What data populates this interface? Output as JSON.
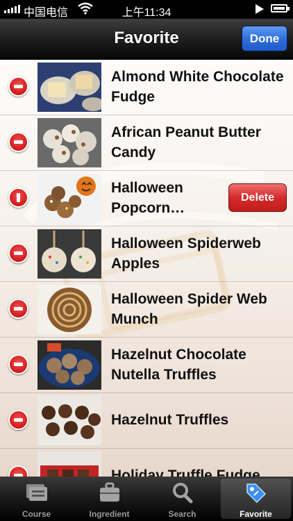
{
  "status_bar": {
    "carrier": "中国电信",
    "time": "上午11:34"
  },
  "nav": {
    "title": "Favorite",
    "done_label": "Done"
  },
  "list": {
    "items": [
      {
        "title": "Almond White Chocolate Fudge",
        "control": "remove"
      },
      {
        "title": "African Peanut Butter Candy",
        "control": "remove"
      },
      {
        "title": "Halloween Popcorn…",
        "control": "confirm",
        "delete_label": "Delete"
      },
      {
        "title": "Halloween Spiderweb Apples",
        "control": "remove"
      },
      {
        "title": "Halloween Spider Web Munch",
        "control": "remove"
      },
      {
        "title": "Hazelnut Chocolate Nutella Truffles",
        "control": "remove"
      },
      {
        "title": "Hazelnut Truffles",
        "control": "remove"
      },
      {
        "title": "Holiday Truffle Fudge",
        "control": "remove"
      }
    ],
    "watermark_icon": "recipes-logo-watermark"
  },
  "tab_bar": {
    "tabs": [
      {
        "label": "Course",
        "icon": "course-icon"
      },
      {
        "label": "Ingredient",
        "icon": "briefcase-icon"
      },
      {
        "label": "Search",
        "icon": "search-icon"
      },
      {
        "label": "Favorite",
        "icon": "tag-icon",
        "selected": true
      }
    ]
  },
  "colors": {
    "delete_red": "#d42a2a",
    "done_blue": "#2f6fdc",
    "bar_dark": "#1e1e1e"
  }
}
